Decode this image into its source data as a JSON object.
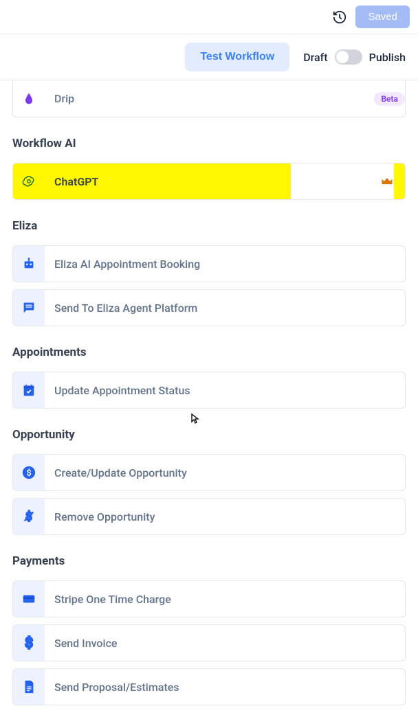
{
  "topbar": {
    "saved_label": "Saved"
  },
  "actionbar": {
    "test_workflow_label": "Test Workflow",
    "draft_label": "Draft",
    "publish_label": "Publish"
  },
  "drip": {
    "label": "Drip",
    "badge": "Beta"
  },
  "sections": {
    "workflow_ai": {
      "header": "Workflow AI",
      "items": {
        "chatgpt": "ChatGPT"
      }
    },
    "eliza": {
      "header": "Eliza",
      "items": {
        "booking": "Eliza AI Appointment Booking",
        "send": "Send To Eliza Agent Platform"
      }
    },
    "appointments": {
      "header": "Appointments",
      "items": {
        "update": "Update Appointment Status"
      }
    },
    "opportunity": {
      "header": "Opportunity",
      "items": {
        "create": "Create/Update Opportunity",
        "remove": "Remove Opportunity"
      }
    },
    "payments": {
      "header": "Payments",
      "items": {
        "stripe": "Stripe One Time Charge",
        "invoice": "Send Invoice",
        "proposal": "Send Proposal/Estimates"
      }
    }
  }
}
